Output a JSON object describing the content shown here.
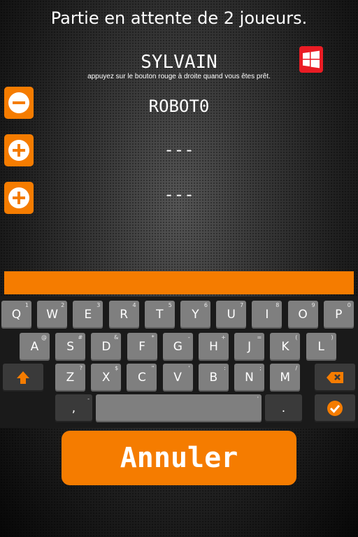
{
  "header": {
    "title": "Partie en attente de 2 joueurs."
  },
  "player": {
    "name": "SYLVAIN",
    "hint": "appuyez sur le bouton rouge à droite quand vous êtes prêt."
  },
  "slots": [
    {
      "action": "remove",
      "name": "ROBOT0"
    },
    {
      "action": "add",
      "name": "---"
    },
    {
      "action": "add",
      "name": "---"
    }
  ],
  "keyboard": {
    "row1": [
      {
        "k": "Q",
        "a": "1"
      },
      {
        "k": "W",
        "a": "2"
      },
      {
        "k": "E",
        "a": "3"
      },
      {
        "k": "R",
        "a": "4"
      },
      {
        "k": "T",
        "a": "5"
      },
      {
        "k": "Y",
        "a": "6"
      },
      {
        "k": "U",
        "a": "7"
      },
      {
        "k": "I",
        "a": "8"
      },
      {
        "k": "O",
        "a": "9"
      },
      {
        "k": "P",
        "a": "0"
      }
    ],
    "row2": [
      {
        "k": "A",
        "a": "@"
      },
      {
        "k": "S",
        "a": "#"
      },
      {
        "k": "D",
        "a": "&"
      },
      {
        "k": "F",
        "a": "*"
      },
      {
        "k": "G",
        "a": "-"
      },
      {
        "k": "H",
        "a": "+"
      },
      {
        "k": "J",
        "a": "="
      },
      {
        "k": "K",
        "a": "("
      },
      {
        "k": "L",
        "a": ")"
      }
    ],
    "row3": [
      {
        "k": "Z",
        "a": "?"
      },
      {
        "k": "X",
        "a": "$"
      },
      {
        "k": "C",
        "a": "\""
      },
      {
        "k": "V",
        "a": "'"
      },
      {
        "k": "B",
        "a": ":"
      },
      {
        "k": "N",
        "a": ";"
      },
      {
        "k": "M",
        "a": "/"
      }
    ],
    "comma": ",",
    "space_alt": "'",
    "period": ".",
    "comma_alt": "-"
  },
  "colors": {
    "accent": "#f57c00",
    "windows_red": "#ea1c24",
    "key": "#7f7f7f"
  },
  "buttons": {
    "cancel": "Annuler"
  }
}
